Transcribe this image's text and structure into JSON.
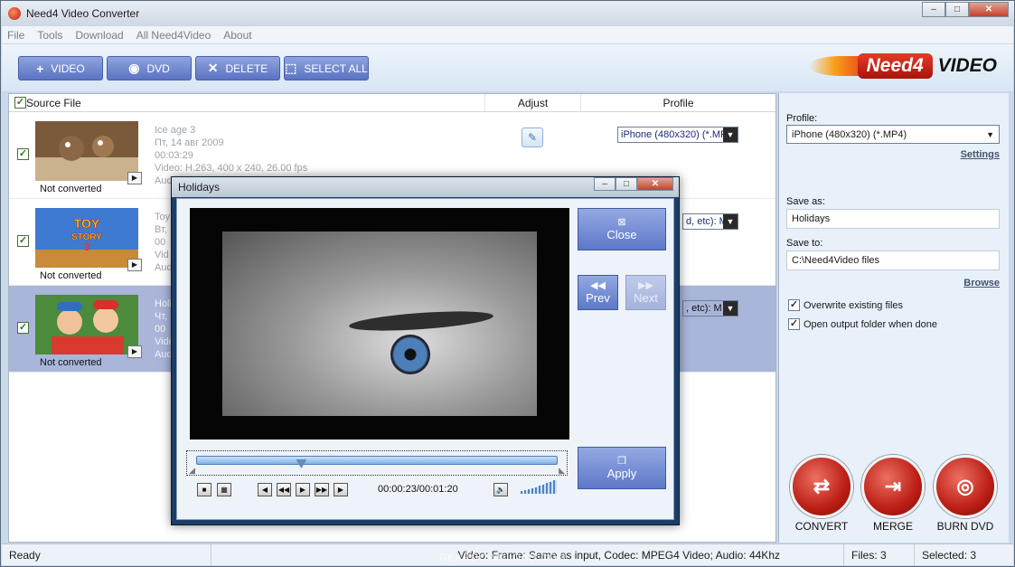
{
  "window": {
    "title": "Need4 Video Converter",
    "minimize": "–",
    "maximize": "□",
    "close": "✕"
  },
  "menu": [
    "File",
    "Tools",
    "Download",
    "All Need4Video",
    "About"
  ],
  "toolbar": {
    "video_label": "VIDEO",
    "dvd_label": "DVD",
    "delete_label": "DELETE",
    "select_all_label": "SELECT ALL"
  },
  "logo": {
    "brand": "Need4",
    "suffix": "VIDEO"
  },
  "list": {
    "headers": {
      "source": "Source File",
      "adjust": "Adjust",
      "profile": "Profile"
    },
    "rows": [
      {
        "status": "Not converted",
        "title": "Ice age 3",
        "date": "Пт, 14 авг 2009",
        "duration": "00:03:29",
        "video": "Video: H.263, 400 x 240, 26.00 fps",
        "audio": "Aud",
        "profile": "iPhone (480x320) (*.MP4)",
        "selected": false
      },
      {
        "status": "Not converted",
        "title": "Toy",
        "date": "Вт,",
        "duration": "00",
        "video": "Vid",
        "audio": "Aud",
        "profile": "d, etc): M",
        "selected": false
      },
      {
        "status": "Not converted",
        "title": "Holi",
        "date": "Чт,",
        "duration": "00",
        "video": "Vide",
        "audio": "Aud",
        "profile": ", etc): M",
        "selected": true
      }
    ]
  },
  "right": {
    "profile_label": "Profile:",
    "profile_value": "iPhone (480x320) (*.MP4)",
    "settings": "Settings",
    "save_as_label": "Save as:",
    "save_as_value": "Holidays",
    "save_to_label": "Save to:",
    "save_to_value": "C:\\Need4Video files",
    "browse": "Browse",
    "overwrite": "Overwrite existing files",
    "open_folder": "Open output folder when done",
    "convert": "CONVERT",
    "merge": "MERGE",
    "burn": "BURN DVD"
  },
  "status": {
    "left": "Ready",
    "info": "Video: Frame: Same as input, Codec: MPEG4 Video; Audio: 44Khz",
    "files": "Files: 3",
    "selected": "Selected: 3"
  },
  "dialog": {
    "title": "Holidays",
    "close_label": "Close",
    "prev_label": "Prev",
    "next_label": "Next",
    "apply_label": "Apply",
    "timecode": "00:00:23/00:01:20",
    "seek_position": 0.29
  },
  "watermark": "GEARDOWNLOAD.COM",
  "colors": {
    "accent": "#5b73c2",
    "selected_row": "#a9b5d9",
    "action": "#bb1e14"
  }
}
